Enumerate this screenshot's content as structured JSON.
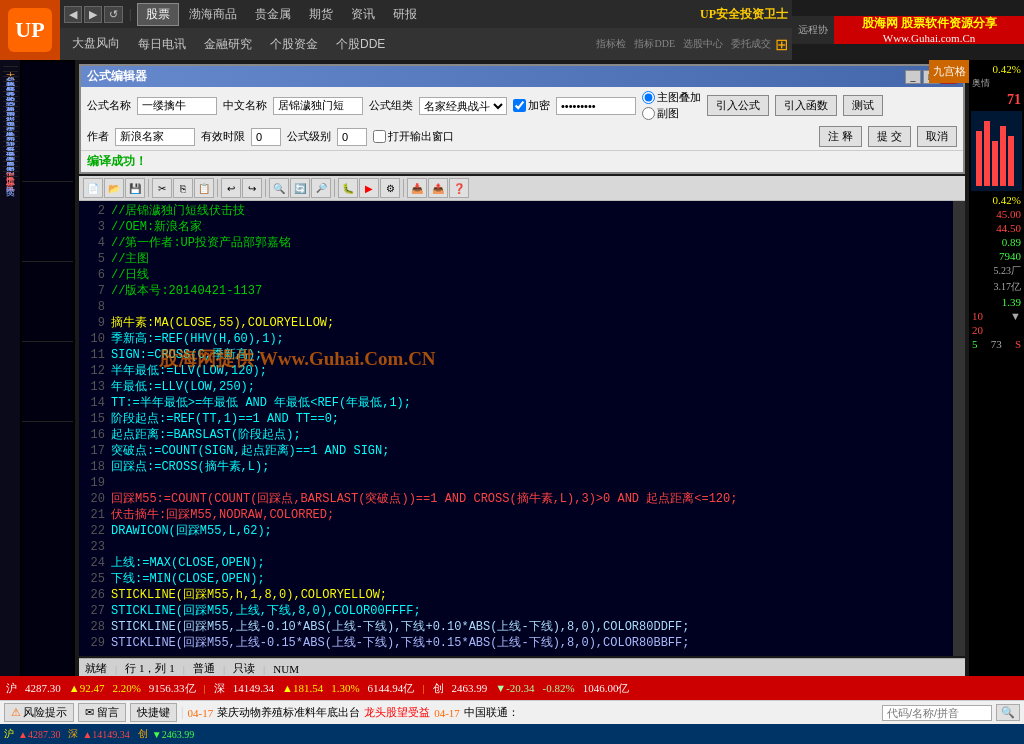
{
  "brand": {
    "logo_text": "UP",
    "title": "股海网 股票软件资源分享",
    "url": "Www.Guhai.com.Cn",
    "slogan": "UP安全投资卫士"
  },
  "top_nav": {
    "back": "◀",
    "forward": "▶",
    "refresh": "↺",
    "stock": "股票",
    "bohai": "渤海商品",
    "metals": "贵金属",
    "futures": "期货",
    "info": "资讯",
    "research": "研报"
  },
  "second_nav": {
    "items": [
      "大盘风向",
      "每日电讯",
      "金融研究",
      "个股资金",
      "个股DDE"
    ]
  },
  "left_sidebar": {
    "items": [
      "大",
      "超实",
      "趋势",
      "能量",
      "成交",
      "均线",
      "宿金",
      "其他",
      "用户",
      "指南",
      "神条",
      "庄家",
      "铁龙",
      "同花",
      "通达",
      "操盘",
      "渤海",
      "贵金",
      "股票",
      "用名",
      "家血",
      "血血",
      "红宝",
      "民交"
    ]
  },
  "formula_editor": {
    "title": "公式编辑器",
    "fields": {
      "formula_name_label": "公式名称",
      "formula_name_value": "一缕擒牛",
      "cn_name_label": "中文名称",
      "cn_name_value": "居锦濊独门短",
      "group_label": "公式组类",
      "group_value": "名家经典战斗",
      "encrypt_label": "加密",
      "encrypt_value": "*********",
      "main_chart_label": "主图叠加",
      "sub_chart_label": "副图",
      "author_label": "作者",
      "author_value": "新浪名家",
      "valid_time_label": "有效时限",
      "valid_time_value": "0",
      "formula_level_label": "公式级别",
      "formula_level_value": "0",
      "open_output_label": "打开输出窗口"
    },
    "buttons": {
      "import_formula": "引入公式",
      "import_func": "引入函数",
      "test": "测试",
      "comment": "注 释",
      "submit": "提 交",
      "cancel": "取消"
    },
    "compile_status": "编译成功！"
  },
  "code_lines": [
    {
      "num": "2",
      "text": "//居锦濊独门短线伏击技",
      "color": "green"
    },
    {
      "num": "3",
      "text": "//OEM:新浪名家",
      "color": "green"
    },
    {
      "num": "4",
      "text": "//第一作者:UP投资产品部郭嘉铭",
      "color": "green"
    },
    {
      "num": "5",
      "text": "//主图",
      "color": "green"
    },
    {
      "num": "6",
      "text": "//日线",
      "color": "green"
    },
    {
      "num": "7",
      "text": "//版本号:20140421-1137",
      "color": "green"
    },
    {
      "num": "8",
      "text": "",
      "color": "white"
    },
    {
      "num": "9",
      "text": "摘牛素:MA(CLOSE,55),COLORYELLOW;",
      "color": "yellow"
    },
    {
      "num": "10",
      "text": "季新高:=REF(HHV(H,60),1);",
      "color": "cyan"
    },
    {
      "num": "11",
      "text": "SIGN:=CROSS(C,季新高);",
      "color": "cyan"
    },
    {
      "num": "12",
      "text": "半年最低:=LLV(LOW,120);",
      "color": "cyan"
    },
    {
      "num": "13",
      "text": "年最低:=LLV(LOW,250);",
      "color": "cyan"
    },
    {
      "num": "14",
      "text": "TT:=半年最低>=年最低 AND 年最低<REF(年最低,1);",
      "color": "cyan"
    },
    {
      "num": "15",
      "text": "阶段起点:=REF(TT,1)==1 AND TT==0;",
      "color": "cyan"
    },
    {
      "num": "16",
      "text": "起点距离:=BARSLAST(阶段起点);",
      "color": "cyan"
    },
    {
      "num": "17",
      "text": "突破点:=COUNT(SIGN,起点距离)==1 AND SIGN;",
      "color": "cyan"
    },
    {
      "num": "18",
      "text": "回踩点:=CROSS(摘牛素,L);",
      "color": "cyan"
    },
    {
      "num": "19",
      "text": "",
      "color": "white"
    },
    {
      "num": "20",
      "text": "回踩M55:=COUNT(COUNT(回踩点,BARSLAST(突破点))==1 AND CROSS(摘牛素,L),3)>0 AND 起点距离<=120;",
      "color": "red"
    },
    {
      "num": "21",
      "text": "伏击摘牛:回踩M55,NODRAW,COLORRED;",
      "color": "red"
    },
    {
      "num": "22",
      "text": "DRAWICON(回踩M55,L,62);",
      "color": "cyan"
    },
    {
      "num": "23",
      "text": "",
      "color": "white"
    },
    {
      "num": "24",
      "text": "上线:=MAX(CLOSE,OPEN);",
      "color": "cyan"
    },
    {
      "num": "25",
      "text": "下线:=MIN(CLOSE,OPEN);",
      "color": "cyan"
    },
    {
      "num": "26",
      "text": "STICKLINE(回踩M55,h,1,8,0),COLORYELLOW;",
      "color": "yellow"
    },
    {
      "num": "27",
      "text": "STICKLINE(回踩M55,上线,下线,8,0),COLOR00FFFF;",
      "color": "cyan"
    },
    {
      "num": "28",
      "text": "STICKLINE(回踩M55,上线-0.10*ABS(上线-下线),下线+0.10*ABS(上线-下线),8,0),COLOR80DDFF;",
      "color": "white"
    },
    {
      "num": "29",
      "text": "STICKLINE(回踩M55,上线-0.15*ABS(上线-下线),下线+0.15*ABS(上线-下线),8,0),COLOR80BBFF;",
      "color": "white"
    }
  ],
  "status_bar": {
    "label": "就绪",
    "position": "行 1，列 1",
    "mode": "普通",
    "readonly": "只读",
    "num": "NUM"
  },
  "right_panel": {
    "pct1": "0.42%",
    "label1": "奥情",
    "val1": "71",
    "pct2": "0.42%",
    "val2": "45.00",
    "val3": "44.50",
    "val4": "0.89",
    "val5": "7940",
    "val6": "5.23厂",
    "val7": "3.17亿",
    "val8": "1.39",
    "val9": "10",
    "val10": "20",
    "val11": "5",
    "val12": "73",
    "val13": "S"
  },
  "nine_grid": "九宫格",
  "bottom_ticker": {
    "items": [
      {
        "label": "沪",
        "value": "4287.30",
        "change": "▲92.47",
        "pct": "2.20%",
        "amount": "9156.33亿"
      },
      {
        "label": "深",
        "value": "14149.34",
        "change": "▲181.54",
        "pct": "1.30%",
        "amount": "6144.94亿"
      },
      {
        "label": "创",
        "value": "2463.99",
        "change": "▼-20.34",
        "pct": "-0.82%",
        "amount": "1046.00亿"
      }
    ]
  },
  "bottom_status": {
    "risk_label": "风险提示",
    "message_label": "留言",
    "shortcut_label": "快捷键",
    "news1_date": "04-17",
    "news1_text": "菜庆动物养殖标准料年底出台",
    "news2_text": "龙头股望受益",
    "news3_date": "04-17",
    "news3_text": "中国联通：",
    "input_placeholder": "代码/名称/拼音"
  },
  "toolbar_icons": [
    "new",
    "open",
    "save",
    "cut",
    "copy",
    "paste",
    "undo",
    "redo",
    "find",
    "replace",
    "search-all",
    "debug",
    "run",
    "settings",
    "import",
    "export",
    "help"
  ]
}
